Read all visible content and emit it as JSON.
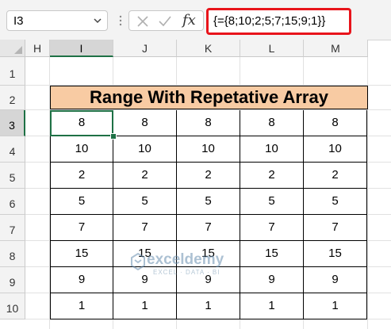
{
  "formula_bar": {
    "name_box": "I3",
    "fx_label": "fx",
    "formula": "{={8;10;2;5;7;15;9;1}}"
  },
  "columns": [
    "H",
    "I",
    "J",
    "K",
    "L",
    "M"
  ],
  "rows": [
    "1",
    "2",
    "3",
    "4",
    "5",
    "6",
    "7",
    "8",
    "9",
    "10"
  ],
  "selected_column": "I",
  "selected_row": "3",
  "table": {
    "title": "Range With Repetative Array",
    "values": [
      [
        "8",
        "8",
        "8",
        "8",
        "8"
      ],
      [
        "10",
        "10",
        "10",
        "10",
        "10"
      ],
      [
        "2",
        "2",
        "2",
        "2",
        "2"
      ],
      [
        "5",
        "5",
        "5",
        "5",
        "5"
      ],
      [
        "7",
        "7",
        "7",
        "7",
        "7"
      ],
      [
        "15",
        "15",
        "15",
        "15",
        "15"
      ],
      [
        "9",
        "9",
        "9",
        "9",
        "9"
      ],
      [
        "1",
        "1",
        "1",
        "1",
        "1"
      ]
    ]
  },
  "watermark": {
    "name": "exceldemy",
    "tagline": "EXCEL · DATA · BI"
  },
  "colors": {
    "title_fill": "#f8cba3",
    "selection": "#1e7145",
    "formula_highlight": "#e8141b"
  },
  "icons": [
    "chevron-down-icon",
    "cancel-icon",
    "enter-check-icon",
    "function-icon",
    "exceldemy-logo-icon"
  ]
}
